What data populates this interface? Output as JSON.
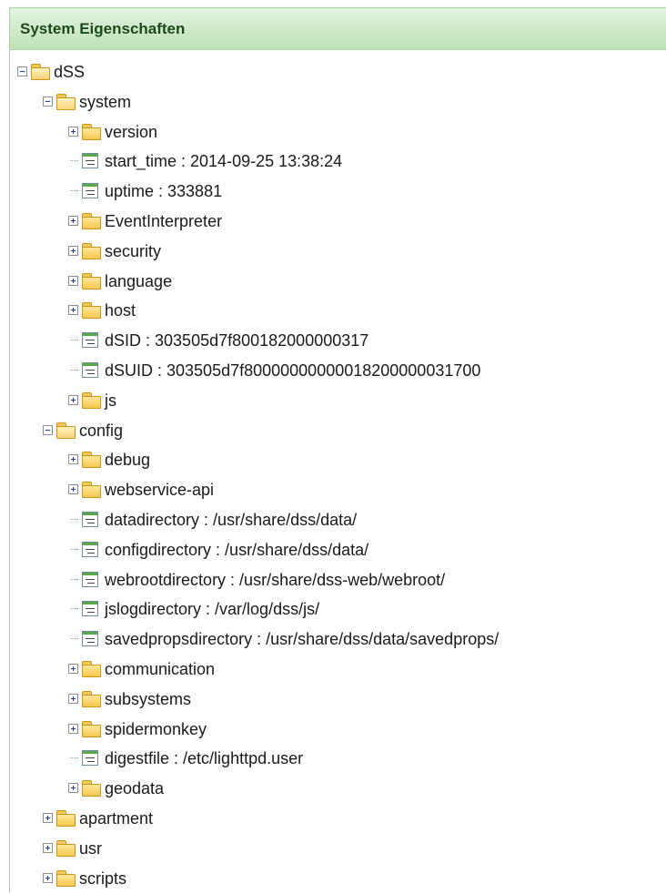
{
  "panel": {
    "title": "System Eigenschaften"
  },
  "tree": [
    {
      "label": "dSS",
      "level": 0,
      "type": "folder",
      "expanded": true
    },
    {
      "label": "system",
      "level": 1,
      "type": "folder",
      "expanded": true
    },
    {
      "label": "version",
      "level": 2,
      "type": "folder",
      "expanded": false
    },
    {
      "label": "start_time : 2014-09-25 13:38:24",
      "level": 2,
      "type": "leaf"
    },
    {
      "label": "uptime : 333881",
      "level": 2,
      "type": "leaf"
    },
    {
      "label": "EventInterpreter",
      "level": 2,
      "type": "folder",
      "expanded": false
    },
    {
      "label": "security",
      "level": 2,
      "type": "folder",
      "expanded": false
    },
    {
      "label": "language",
      "level": 2,
      "type": "folder",
      "expanded": false
    },
    {
      "label": "host",
      "level": 2,
      "type": "folder",
      "expanded": false
    },
    {
      "label": "dSID : 303505d7f800182000000317",
      "level": 2,
      "type": "leaf"
    },
    {
      "label": "dSUID : 303505d7f80000000000018200000031700",
      "level": 2,
      "type": "leaf"
    },
    {
      "label": "js",
      "level": 2,
      "type": "folder",
      "expanded": false
    },
    {
      "label": "config",
      "level": 1,
      "type": "folder",
      "expanded": true
    },
    {
      "label": "debug",
      "level": 2,
      "type": "folder",
      "expanded": false
    },
    {
      "label": "webservice-api",
      "level": 2,
      "type": "folder",
      "expanded": false
    },
    {
      "label": "datadirectory : /usr/share/dss/data/",
      "level": 2,
      "type": "leaf"
    },
    {
      "label": "configdirectory : /usr/share/dss/data/",
      "level": 2,
      "type": "leaf"
    },
    {
      "label": "webrootdirectory : /usr/share/dss-web/webroot/",
      "level": 2,
      "type": "leaf"
    },
    {
      "label": "jslogdirectory : /var/log/dss/js/",
      "level": 2,
      "type": "leaf"
    },
    {
      "label": "savedpropsdirectory : /usr/share/dss/data/savedprops/",
      "level": 2,
      "type": "leaf"
    },
    {
      "label": "communication",
      "level": 2,
      "type": "folder",
      "expanded": false
    },
    {
      "label": "subsystems",
      "level": 2,
      "type": "folder",
      "expanded": false
    },
    {
      "label": "spidermonkey",
      "level": 2,
      "type": "folder",
      "expanded": false
    },
    {
      "label": "digestfile : /etc/lighttpd.user",
      "level": 2,
      "type": "leaf"
    },
    {
      "label": "geodata",
      "level": 2,
      "type": "folder",
      "expanded": false
    },
    {
      "label": "apartment",
      "level": 1,
      "type": "folder",
      "expanded": false
    },
    {
      "label": "usr",
      "level": 1,
      "type": "folder",
      "expanded": false
    },
    {
      "label": "scripts",
      "level": 1,
      "type": "folder",
      "expanded": false
    }
  ]
}
